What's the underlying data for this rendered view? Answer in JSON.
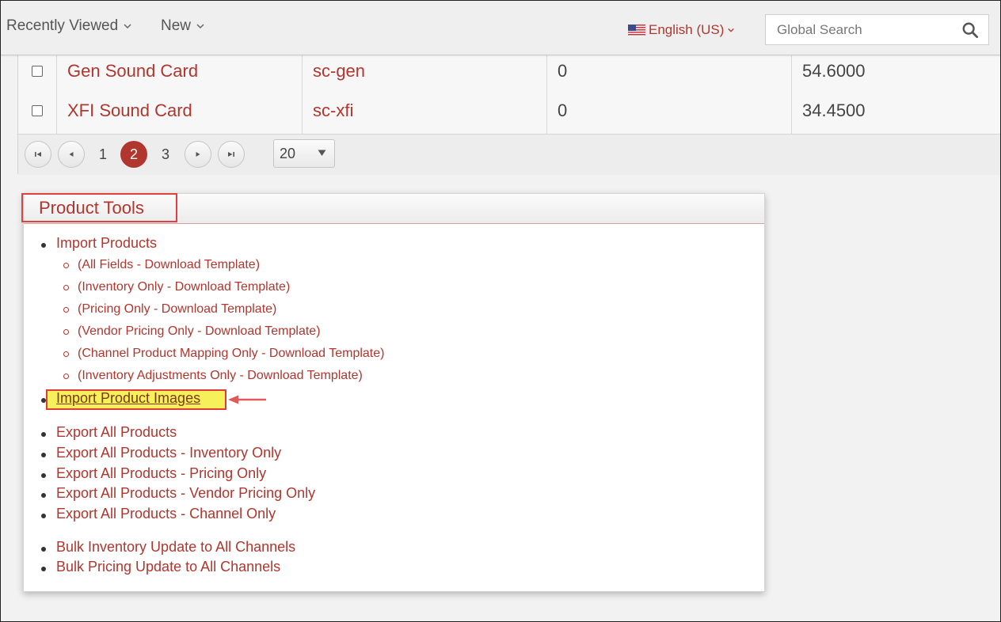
{
  "header": {
    "recently_viewed": "Recently Viewed",
    "new": "New",
    "language": "English (US)",
    "search_placeholder": "Global Search"
  },
  "grid": {
    "rows": [
      {
        "name": "Gen Sound Card",
        "sku": "sc-gen",
        "qty": "0",
        "price": "54.6000"
      },
      {
        "name": "XFI Sound Card",
        "sku": "sc-xfi",
        "qty": "0",
        "price": "34.4500"
      }
    ],
    "pager": {
      "pages": [
        "1",
        "2",
        "3"
      ],
      "current_page": "2",
      "page_size": "20"
    }
  },
  "product_tools": {
    "title": "Product Tools",
    "import_products": "Import Products",
    "import_templates": [
      "(All Fields - Download Template)",
      "(Inventory Only - Download Template)",
      "(Pricing Only - Download Template)",
      "(Vendor Pricing Only - Download Template)",
      "(Channel Product Mapping Only - Download Template)",
      "(Inventory Adjustments Only - Download Template)"
    ],
    "import_images": "Import Product Images",
    "exports": [
      "Export All Products",
      "Export All Products - Inventory Only",
      "Export All Products - Pricing Only",
      "Export All Products - Vendor Pricing Only",
      "Export All Products - Channel Only"
    ],
    "bulk": [
      "Bulk Inventory Update to All Channels",
      "Bulk Pricing Update to All Channels"
    ]
  },
  "colors": {
    "accent": "#b0362e",
    "highlight": "#f6f05a",
    "callout": "#e03a3a"
  }
}
